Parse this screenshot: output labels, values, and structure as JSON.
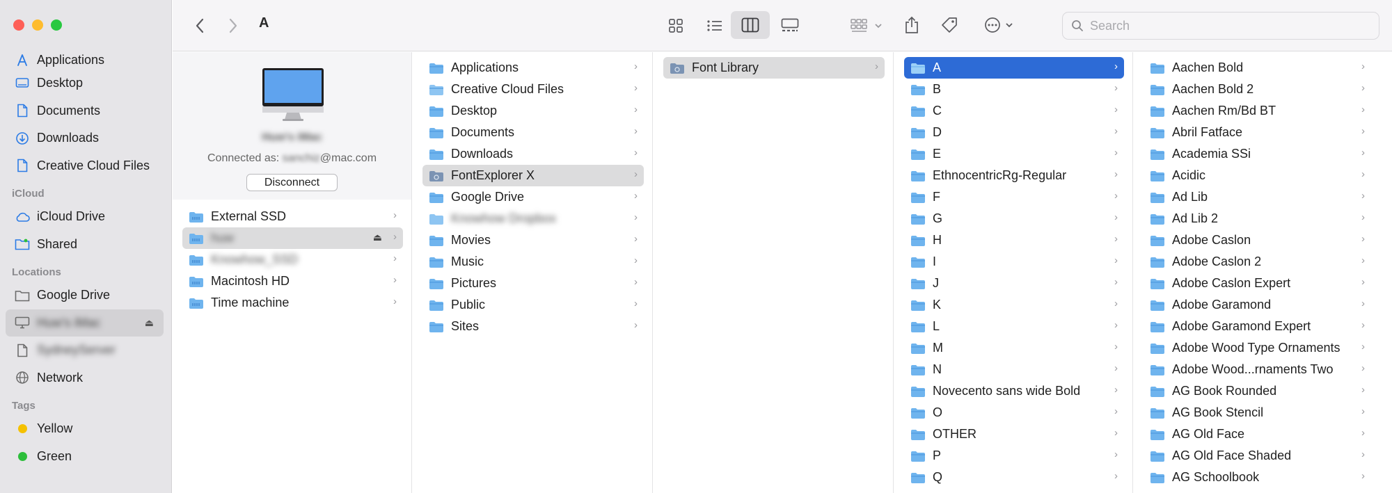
{
  "window": {
    "title": "A"
  },
  "sidebar": {
    "favorites": [
      {
        "label": "Applications",
        "icon": "applications-icon"
      },
      {
        "label": "Desktop",
        "icon": "desktop-icon"
      },
      {
        "label": "Documents",
        "icon": "document-icon"
      },
      {
        "label": "Downloads",
        "icon": "downloads-icon"
      },
      {
        "label": "Creative Cloud Files",
        "icon": "document-icon"
      }
    ],
    "icloud_header": "iCloud",
    "icloud": [
      {
        "label": "iCloud Drive",
        "icon": "cloud-icon"
      },
      {
        "label": "Shared",
        "icon": "shared-folder-icon"
      }
    ],
    "locations_header": "Locations",
    "locations": [
      {
        "label": "Google Drive",
        "icon": "folder-icon"
      },
      {
        "label": "Huw's iMac",
        "icon": "computer-icon"
      },
      {
        "label": "SydneyServer",
        "icon": "document-icon"
      },
      {
        "label": "Network",
        "icon": "network-icon"
      }
    ],
    "tags_header": "Tags",
    "tags": [
      {
        "label": "Yellow",
        "color": "#f5c100"
      },
      {
        "label": "Green",
        "color": "#2dbe3b"
      }
    ]
  },
  "toolbar": {
    "search_placeholder": "Search"
  },
  "column1": {
    "computer_name": "Huw's iMac",
    "connected_prefix": "Connected as:",
    "connected_user": "sanchiz",
    "connected_domain": "@mac.com",
    "disconnect_label": "Disconnect",
    "items": [
      "External SSD",
      "huw",
      "Knowhow_SSD",
      "Macintosh HD",
      "Time machine"
    ]
  },
  "column2": {
    "items": [
      "Applications",
      "Creative Cloud Files",
      "Desktop",
      "Documents",
      "Downloads",
      "FontExplorer X",
      "Google Drive",
      "Knowhow Dropbox",
      "Movies",
      "Music",
      "Pictures",
      "Public",
      "Sites"
    ]
  },
  "column3": {
    "items": [
      "Font Library"
    ]
  },
  "column4": {
    "items": [
      "A",
      "B",
      "C",
      "D",
      "E",
      "EthnocentricRg-Regular",
      "F",
      "G",
      "H",
      "I",
      "J",
      "K",
      "L",
      "M",
      "N",
      "Novecento sans wide Bold",
      "O",
      "OTHER",
      "P",
      "Q"
    ]
  },
  "column5": {
    "items": [
      "Aachen Bold",
      "Aachen Bold 2",
      "Aachen Rm/Bd BT",
      "Abril Fatface",
      "Academia SSi",
      "Acidic",
      "Ad Lib",
      "Ad Lib 2",
      "Adobe Caslon",
      "Adobe Caslon 2",
      "Adobe Caslon Expert",
      "Adobe Garamond",
      "Adobe Garamond Expert",
      "Adobe Wood Type Ornaments",
      "Adobe Wood...rnaments Two",
      "AG Book Rounded",
      "AG Book Stencil",
      "AG Old Face",
      "AG Old Face Shaded",
      "AG Schoolbook"
    ]
  },
  "colors": {
    "selection": "#2d6bd6",
    "folder": "#5aa9e6",
    "sidebar_icon": "#2b7be5"
  }
}
